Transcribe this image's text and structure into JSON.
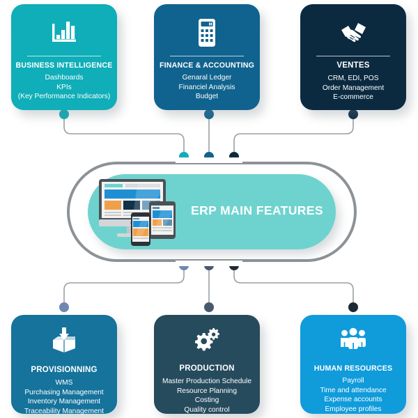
{
  "diagram": {
    "center": {
      "title": "ERP MAIN FEATURES",
      "illustration": "responsive-devices-illustration",
      "pill_color": "#6ED3CF",
      "ring_color": "#8d9296"
    },
    "nodes": [
      {
        "id": "business-intelligence",
        "title": "BUSINESS INTELLIGENCE",
        "icon": "bar-chart-icon",
        "color": "#0FAEB8",
        "dot_color": "#0FAEB8",
        "lines": [
          "Dashboards",
          "KPIs",
          "(Key Performance Indicators)"
        ]
      },
      {
        "id": "finance-accounting",
        "title": "FINANCE & ACCOUNTING",
        "icon": "calculator-icon",
        "color": "#10638E",
        "dot_color": "#10638E",
        "lines": [
          "Genaral Ledger",
          "Financiel Analysis",
          "Budget"
        ]
      },
      {
        "id": "ventes",
        "title": "VENTES",
        "icon": "handshake-icon",
        "color": "#0B2A40",
        "dot_color": "#0B2A40",
        "lines": [
          "CRM, EDI, POS",
          "Order Management",
          "E-commerce"
        ]
      },
      {
        "id": "provisionning",
        "title": "PROVISIONNING",
        "icon": "inbox-box-icon",
        "color": "#15739C",
        "dot_color": "#6F88B0",
        "lines": [
          "WMS",
          "Purchasing Management",
          "Inventory Management",
          "Traceability Management"
        ]
      },
      {
        "id": "production",
        "title": "PRODUCTION",
        "icon": "gears-icon",
        "color": "#264B5D",
        "dot_color": "#47596E",
        "lines": [
          "Master Production Schedule",
          "Resource Planning",
          "Costing",
          "Quality control"
        ]
      },
      {
        "id": "human-resources",
        "title": "HUMAN RESOURCES",
        "icon": "people-group-icon",
        "color": "#109BDB",
        "dot_color": "#1D2A33",
        "lines": [
          "Payroll",
          "Time and attendance",
          "Expense accounts",
          "Employee profiles"
        ]
      }
    ]
  }
}
